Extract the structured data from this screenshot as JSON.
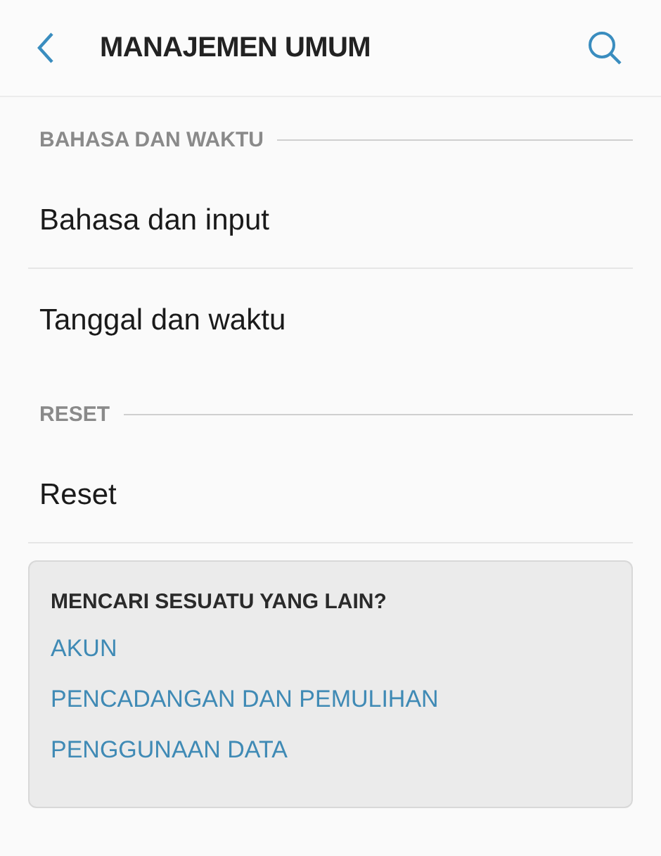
{
  "header": {
    "title": "MANAJEMEN UMUM"
  },
  "sections": [
    {
      "title": "BAHASA DAN WAKTU",
      "items": [
        "Bahasa dan input",
        "Tanggal dan waktu"
      ]
    },
    {
      "title": "RESET",
      "items": [
        "Reset"
      ]
    }
  ],
  "suggestions": {
    "title": "MENCARI SESUATU YANG LAIN?",
    "links": [
      "AKUN",
      "PENCADANGAN DAN PEMULIHAN",
      "PENGGUNAAN DATA"
    ]
  }
}
